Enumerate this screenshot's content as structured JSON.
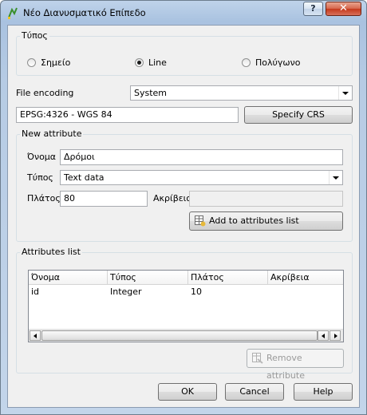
{
  "window": {
    "title": "Νέο Διανυσματικό Επίπεδο",
    "help_button": "?",
    "close_button": "✕"
  },
  "type_group": {
    "label": "Τύπος",
    "options": [
      {
        "label": "Σημείο",
        "checked": false
      },
      {
        "label": "Line",
        "checked": true
      },
      {
        "label": "Πολύγωνο",
        "checked": false
      }
    ]
  },
  "encoding": {
    "label": "File encoding",
    "value": "System"
  },
  "crs": {
    "value": "EPSG:4326 - WGS 84",
    "specify_button": "Specify CRS"
  },
  "new_attribute": {
    "label": "New attribute",
    "name_label": "Όνομα",
    "name_value": "Δρόμοι",
    "type_label": "Τύπος",
    "type_value": "Text data",
    "width_label": "Πλάτος",
    "width_value": "80",
    "precision_label": "Ακρίβεια",
    "precision_value": "",
    "add_button": "Add to attributes list"
  },
  "attributes_list": {
    "label": "Attributes list",
    "columns": [
      "Όνομα",
      "Τύπος",
      "Πλάτος",
      "Ακρίβεια"
    ],
    "rows": [
      [
        "id",
        "Integer",
        "10",
        ""
      ]
    ],
    "remove_button": "Remove attribute"
  },
  "footer": {
    "ok": "OK",
    "cancel": "Cancel",
    "help": "Help"
  }
}
